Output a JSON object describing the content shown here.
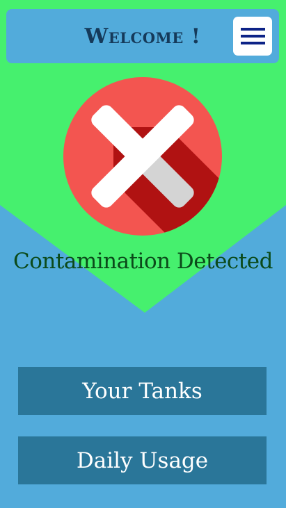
{
  "header": {
    "title": "Welcome !",
    "menu_icon": "hamburger-menu-icon"
  },
  "status": {
    "icon": "close-x-icon",
    "message": "Contamination Detected"
  },
  "actions": {
    "tanks_label": "Your Tanks",
    "usage_label": "Daily Usage"
  },
  "colors": {
    "background_blue": "#52abdb",
    "green": "#46f06e",
    "button_blue": "#2a7699",
    "alert_red": "#f35550",
    "menu_navy": "#0d2387"
  }
}
